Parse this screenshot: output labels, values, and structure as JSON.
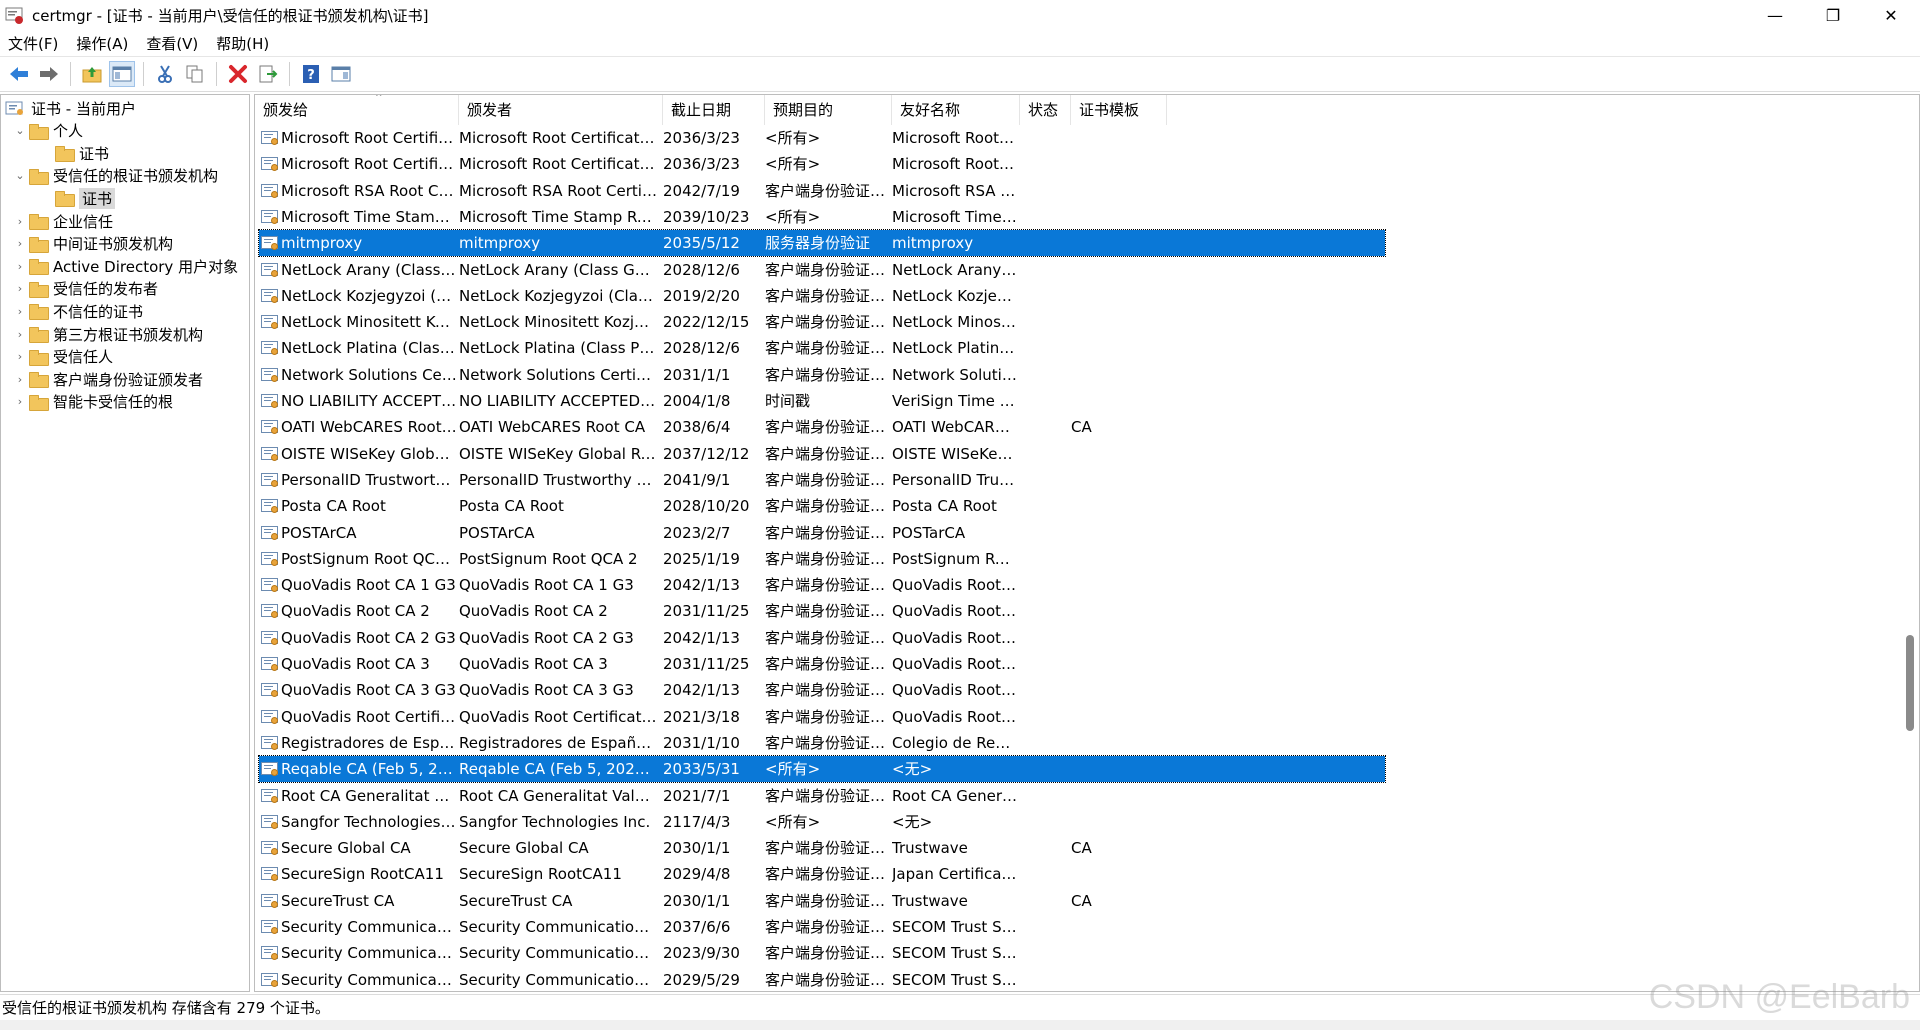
{
  "window": {
    "title": "certmgr - [证书 - 当前用户\\受信任的根证书颁发机构\\证书]",
    "controls": {
      "minimize": "—",
      "restore": "❐",
      "close": "✕"
    }
  },
  "menu": [
    "文件(F)",
    "操作(A)",
    "查看(V)",
    "帮助(H)"
  ],
  "tree": [
    {
      "label": "证书 - 当前用户",
      "chev": "",
      "icon": "cert-store-icon"
    },
    {
      "label": "个人",
      "chev": "⌄",
      "icon": "folder"
    },
    {
      "label": "证书",
      "chev": "",
      "icon": "folder"
    },
    {
      "label": "受信任的根证书颁发机构",
      "chev": "⌄",
      "icon": "folder"
    },
    {
      "label": "证书",
      "chev": "",
      "icon": "folder",
      "selected": true
    },
    {
      "label": "企业信任",
      "chev": "›",
      "icon": "folder"
    },
    {
      "label": "中间证书颁发机构",
      "chev": "›",
      "icon": "folder"
    },
    {
      "label": "Active Directory 用户对象",
      "chev": "›",
      "icon": "folder"
    },
    {
      "label": "受信任的发布者",
      "chev": "›",
      "icon": "folder"
    },
    {
      "label": "不信任的证书",
      "chev": "›",
      "icon": "folder"
    },
    {
      "label": "第三方根证书颁发机构",
      "chev": "›",
      "icon": "folder"
    },
    {
      "label": "受信任人",
      "chev": "›",
      "icon": "folder"
    },
    {
      "label": "客户端身份验证颁发者",
      "chev": "›",
      "icon": "folder"
    },
    {
      "label": "智能卡受信任的根",
      "chev": "›",
      "icon": "folder"
    }
  ],
  "columns": [
    "颁发给",
    "颁发者",
    "截止日期",
    "预期目的",
    "友好名称",
    "状态",
    "证书模板"
  ],
  "rows": [
    [
      "Microsoft Root Certificate Aut...",
      "Microsoft Root Certificate Author...",
      "2036/3/23",
      "<所有>",
      "Microsoft Root Cer...",
      "",
      ""
    ],
    [
      "Microsoft Root Certificate Aut...",
      "Microsoft Root Certificate Author...",
      "2036/3/23",
      "<所有>",
      "Microsoft Root Cer...",
      "",
      ""
    ],
    [
      "Microsoft RSA Root Certificate...",
      "Microsoft RSA Root Certificate A...",
      "2042/7/19",
      "客户端身份验证, 服...",
      "Microsoft RSA Roo...",
      "",
      ""
    ],
    [
      "Microsoft Time Stamp Root Ce...",
      "Microsoft Time Stamp Root Certi...",
      "2039/10/23",
      "<所有>",
      "Microsoft Time Sta...",
      "",
      ""
    ],
    [
      "mitmproxy",
      "mitmproxy",
      "2035/5/12",
      "服务器身份验证",
      "mitmproxy",
      "",
      "",
      true
    ],
    [
      "NetLock Arany (Class Gold) Főt...",
      "NetLock Arany (Class Gold) Főta...",
      "2028/12/6",
      "客户端身份验证, 代...",
      "NetLock Arany (Cla...",
      "",
      ""
    ],
    [
      "NetLock Kozjegyzoi (Class A) T...",
      "NetLock Kozjegyzoi (Class A) Ta...",
      "2019/2/20",
      "客户端身份验证, 加...",
      "NetLock Kozjegyz...",
      "",
      ""
    ],
    [
      "NetLock Minositett Kozjegyzoi...",
      "NetLock Minositett Kozjegyzoi (...",
      "2022/12/15",
      "客户端身份验证, 代...",
      "NetLock Minositett...",
      "",
      ""
    ],
    [
      "NetLock Platina (Class Platinu...",
      "NetLock Platina (Class Platinum) ...",
      "2028/12/6",
      "客户端身份验证, 代...",
      "NetLock Platina (Cl...",
      "",
      ""
    ],
    [
      "Network Solutions Certificate ...",
      "Network Solutions Certificate Au...",
      "2031/1/1",
      "客户端身份验证, 代...",
      "Network Solutions",
      "",
      ""
    ],
    [
      "NO LIABILITY ACCEPTED, (c)9...",
      "NO LIABILITY ACCEPTED, (c)97 ...",
      "2004/1/8",
      "时间戳",
      "VeriSign Time Sta...",
      "",
      ""
    ],
    [
      "OATI WebCARES Root CA",
      "OATI WebCARES Root CA",
      "2038/6/4",
      "客户端身份验证, 安...",
      "OATI WebCARES ...",
      "",
      "CA"
    ],
    [
      "OISTE WISeKey Global Root G...",
      "OISTE WISeKey Global Root GA ...",
      "2037/12/12",
      "客户端身份验证, 代...",
      "OISTE WISeKey Gl...",
      "",
      ""
    ],
    [
      "PersonalID Trustworthy RootC...",
      "PersonalID Trustworthy RootCA ...",
      "2041/9/1",
      "客户端身份验证, 代...",
      "PersonalID Trustwo...",
      "",
      ""
    ],
    [
      "Posta CA Root",
      "Posta CA Root",
      "2028/10/20",
      "客户端身份验证, 代...",
      "Posta CA Root",
      "",
      ""
    ],
    [
      "POSTArCA",
      "POSTArCA",
      "2023/2/7",
      "客户端身份验证, 加...",
      "POSTarCA",
      "",
      ""
    ],
    [
      "PostSignum Root QCA 2",
      "PostSignum Root QCA 2",
      "2025/1/19",
      "客户端身份验证, 安...",
      "PostSignum Root ...",
      "",
      ""
    ],
    [
      "QuoVadis Root CA 1 G3",
      "QuoVadis Root CA 1 G3",
      "2042/1/13",
      "客户端身份验证, 代...",
      "QuoVadis Root CA ...",
      "",
      ""
    ],
    [
      "QuoVadis Root CA 2",
      "QuoVadis Root CA 2",
      "2031/11/25",
      "客户端身份验证, 代...",
      "QuoVadis Root CA 2",
      "",
      ""
    ],
    [
      "QuoVadis Root CA 2 G3",
      "QuoVadis Root CA 2 G3",
      "2042/1/13",
      "客户端身份验证, 代...",
      "QuoVadis Root CA ...",
      "",
      ""
    ],
    [
      "QuoVadis Root CA 3",
      "QuoVadis Root CA 3",
      "2031/11/25",
      "客户端身份验证, 代...",
      "QuoVadis Root CA 3",
      "",
      ""
    ],
    [
      "QuoVadis Root CA 3 G3",
      "QuoVadis Root CA 3 G3",
      "2042/1/13",
      "客户端身份验证, 代...",
      "QuoVadis Root CA ...",
      "",
      ""
    ],
    [
      "QuoVadis Root Certification A...",
      "QuoVadis Root Certification Aut...",
      "2021/3/18",
      "客户端身份验证, 代...",
      "QuoVadis Root Cer...",
      "",
      ""
    ],
    [
      "Registradores de España - CA ...",
      "Registradores de España - CA Raíz",
      "2031/1/10",
      "客户端身份验证, 安...",
      "Colegio de Registr...",
      "",
      ""
    ],
    [
      "Reqable CA (Feb 5, 2025, DF0...",
      "Reqable CA (Feb 5, 2025, DF02D...",
      "2033/5/31",
      "<所有>",
      "<无>",
      "",
      "",
      true
    ],
    [
      "Root CA Generalitat Valenciana",
      "Root CA Generalitat Valenciana",
      "2021/7/1",
      "客户端身份验证, 代...",
      "Root CA Generalita...",
      "",
      ""
    ],
    [
      "Sangfor Technologies Inc.",
      "Sangfor Technologies Inc.",
      "2117/4/3",
      "<所有>",
      "<无>",
      "",
      ""
    ],
    [
      "Secure Global CA",
      "Secure Global CA",
      "2030/1/1",
      "客户端身份验证, 代...",
      "Trustwave",
      "",
      "CA"
    ],
    [
      "SecureSign RootCA11",
      "SecureSign RootCA11",
      "2029/4/8",
      "客户端身份验证, 代...",
      "Japan Certification ...",
      "",
      ""
    ],
    [
      "SecureTrust CA",
      "SecureTrust CA",
      "2030/1/1",
      "客户端身份验证, 代...",
      "Trustwave",
      "",
      "CA"
    ],
    [
      "Security Communication EV R...",
      "Security Communication EV Roo...",
      "2037/6/6",
      "客户端身份验证, 代...",
      "SECOM Trust Syste...",
      "",
      ""
    ],
    [
      "Security Communication Root...",
      "Security Communication RootCA1",
      "2023/9/30",
      "客户端身份验证, 代...",
      "SECOM Trust Syste...",
      "",
      ""
    ],
    [
      "Security Communication Root...",
      "Security Communication RootCA2",
      "2029/5/29",
      "客户端身份验证, 代...",
      "SECOM Trust Syste...",
      "",
      ""
    ]
  ],
  "status": "受信任的根证书颁发机构 存储含有 279 个证书。",
  "watermark": "CSDN @EelBarb",
  "colors": {
    "selection": "#0a78d7",
    "folder": "#f2c55c",
    "delete_icon": "#d9262c",
    "help_icon": "#2b5fb3"
  }
}
